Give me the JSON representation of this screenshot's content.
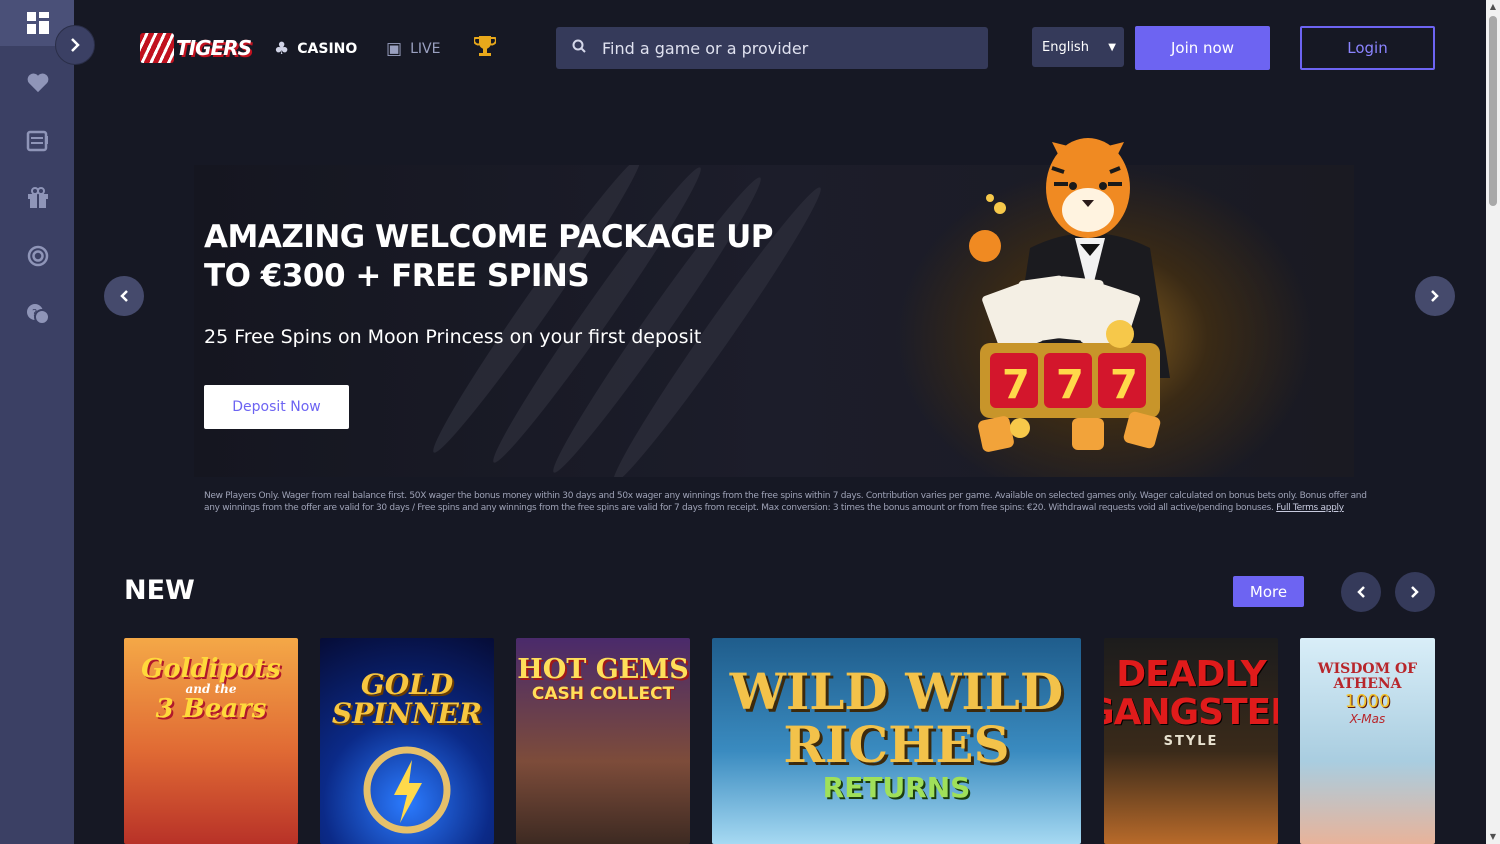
{
  "sidebar": {
    "items": [
      {
        "name": "dashboard-icon",
        "glyph": "▦"
      },
      {
        "name": "heart-icon",
        "glyph": "♥"
      },
      {
        "name": "slot-machine-icon",
        "glyph": "▤"
      },
      {
        "name": "gift-icon",
        "glyph": "🎁"
      },
      {
        "name": "target-icon",
        "glyph": "◎"
      },
      {
        "name": "support-icon",
        "glyph": "☏"
      }
    ],
    "expand_glyph": "›"
  },
  "header": {
    "logo_text": "TIGERS",
    "nav": [
      {
        "label": "CASINO",
        "icon": "casino-icon"
      },
      {
        "label": "LIVE",
        "icon": "live-icon"
      }
    ],
    "search_placeholder": "Find a game or a provider",
    "language": "English",
    "join_label": "Join now",
    "login_label": "Login",
    "accent": "#6d64f2"
  },
  "hero": {
    "title": "AMAZING WELCOME PACKAGE UP TO €300 + FREE SPINS",
    "subtitle": "25 Free Spins on Moon Princess on your first deposit",
    "cta_label": "Deposit Now",
    "terms_text": "New Players Only. Wager from real balance first. 50X wager the bonus money within 30 days and 50x wager any winnings from the free spins within 7 days. Contribution varies per game. Available on selected games only. Wager calculated on bonus bets only. Bonus offer and any winnings from the offer are valid for 30 days / Free spins and any winnings from the free spins are valid for 7 days from receipt. Max conversion: 3 times the bonus amount or from free spins: €20. Withdrawal requests void all active/pending bonuses.",
    "terms_link": "Full Terms apply"
  },
  "new_section": {
    "title": "NEW",
    "more_label": "More",
    "games": [
      {
        "line1": "Goldipots",
        "line2": "and the",
        "line3": "3 Bears"
      },
      {
        "line1": "GOLD",
        "line2": "SPINNER",
        "line3": ""
      },
      {
        "line1": "HOT GEMS",
        "line2": "CASH COLLECT",
        "line3": ""
      },
      {
        "line1": "WILD WILD RICHES",
        "line2": "RETURNS",
        "line3": ""
      },
      {
        "line1": "DEADLY GANGSTER",
        "line2": "STYLE",
        "line3": ""
      },
      {
        "line1": "WISDOM OF ATHENA",
        "line2": "1000",
        "line3": "X-Mas"
      }
    ]
  }
}
